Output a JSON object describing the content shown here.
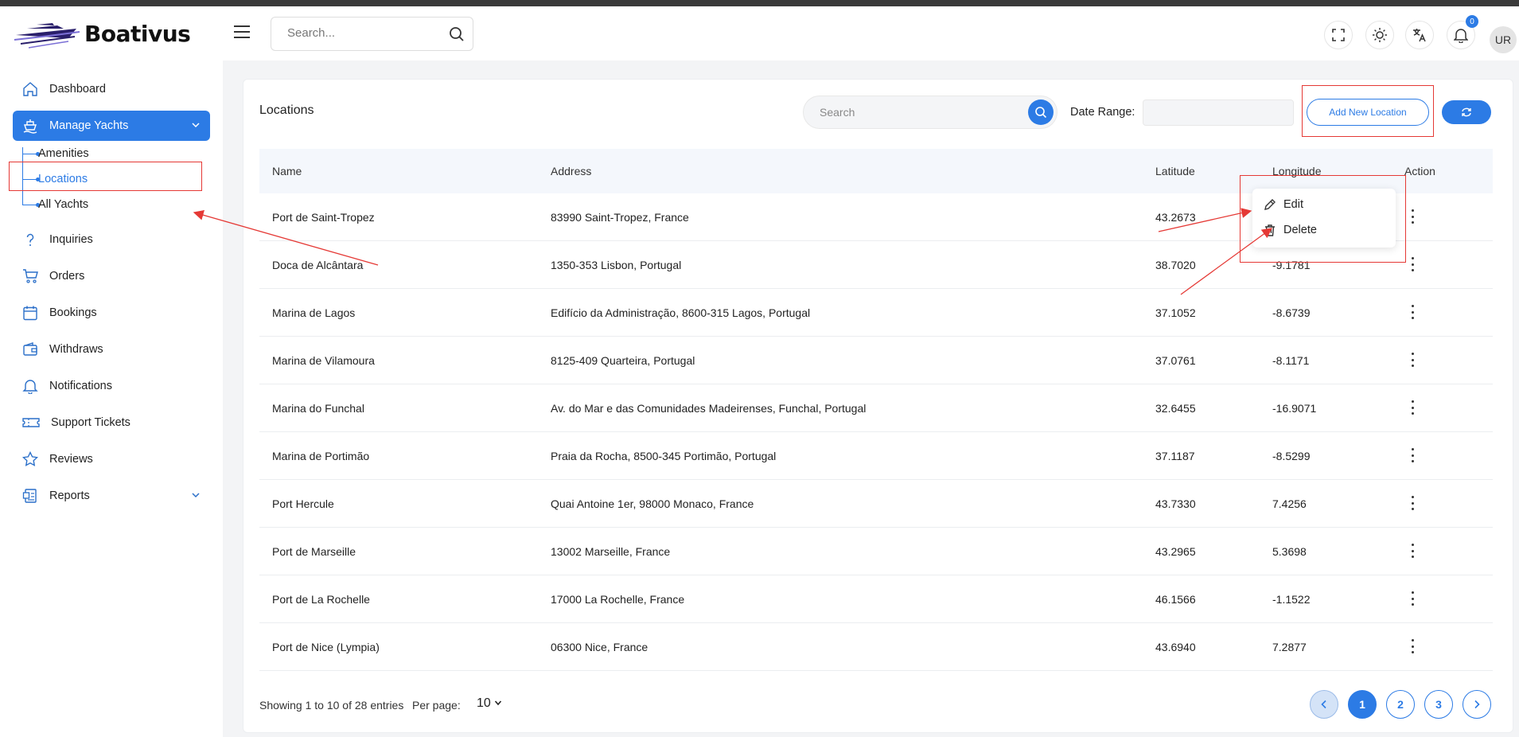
{
  "header": {
    "brand": "Boativus",
    "search_placeholder": "Search...",
    "notification_count": "0",
    "avatar_initials": "UR"
  },
  "sidebar": {
    "items": [
      {
        "label": "Dashboard",
        "icon": "home-icon"
      },
      {
        "label": "Manage Yachts",
        "icon": "yacht-icon",
        "active": true
      },
      {
        "label": "Inquiries",
        "icon": "question-icon"
      },
      {
        "label": "Orders",
        "icon": "cart-icon"
      },
      {
        "label": "Bookings",
        "icon": "calendar-icon"
      },
      {
        "label": "Withdraws",
        "icon": "wallet-icon"
      },
      {
        "label": "Notifications",
        "icon": "bell-icon"
      },
      {
        "label": "Support Tickets",
        "icon": "ticket-icon"
      },
      {
        "label": "Reviews",
        "icon": "star-icon"
      },
      {
        "label": "Reports",
        "icon": "report-icon"
      }
    ],
    "sub_items": [
      "Amenities",
      "Locations",
      "All Yachts"
    ]
  },
  "main": {
    "title": "Locations",
    "search_placeholder": "Search",
    "date_range_label": "Date Range:",
    "add_button": "Add New Location",
    "columns": [
      "Name",
      "Address",
      "Latitude",
      "Longitude",
      "Action"
    ],
    "rows": [
      {
        "name": "Port de Saint-Tropez",
        "address": "83990 Saint-Tropez, France",
        "lat": "43.2673",
        "lng": ""
      },
      {
        "name": "Doca de Alcântara",
        "address": "1350-353 Lisbon, Portugal",
        "lat": "38.7020",
        "lng": "-9.1781"
      },
      {
        "name": "Marina de Lagos",
        "address": "Edifício da Administração, 8600-315 Lagos, Portugal",
        "lat": "37.1052",
        "lng": "-8.6739"
      },
      {
        "name": "Marina de Vilamoura",
        "address": "8125-409 Quarteira, Portugal",
        "lat": "37.0761",
        "lng": "-8.1171"
      },
      {
        "name": "Marina do Funchal",
        "address": "Av. do Mar e das Comunidades Madeirenses, Funchal, Portugal",
        "lat": "32.6455",
        "lng": "-16.9071"
      },
      {
        "name": "Marina de Portimão",
        "address": "Praia da Rocha, 8500-345 Portimão, Portugal",
        "lat": "37.1187",
        "lng": "-8.5299"
      },
      {
        "name": "Port Hercule",
        "address": "Quai Antoine 1er, 98000 Monaco, France",
        "lat": "43.7330",
        "lng": "7.4256"
      },
      {
        "name": "Port de Marseille",
        "address": "13002 Marseille, France",
        "lat": "43.2965",
        "lng": "5.3698"
      },
      {
        "name": "Port de La Rochelle",
        "address": "17000 La Rochelle, France",
        "lat": "46.1566",
        "lng": "-1.1522"
      },
      {
        "name": "Port de Nice (Lympia)",
        "address": "06300 Nice, France",
        "lat": "43.6940",
        "lng": "7.2877"
      }
    ],
    "dropdown": {
      "edit": "Edit",
      "delete": "Delete"
    },
    "footer": {
      "showing": "Showing 1 to 10 of 28 entries",
      "per_page_label": "Per page:",
      "per_page_value": "10",
      "pages": [
        "1",
        "2",
        "3"
      ]
    }
  },
  "colors": {
    "accent": "#2c7be5",
    "annotation": "#e53935"
  }
}
